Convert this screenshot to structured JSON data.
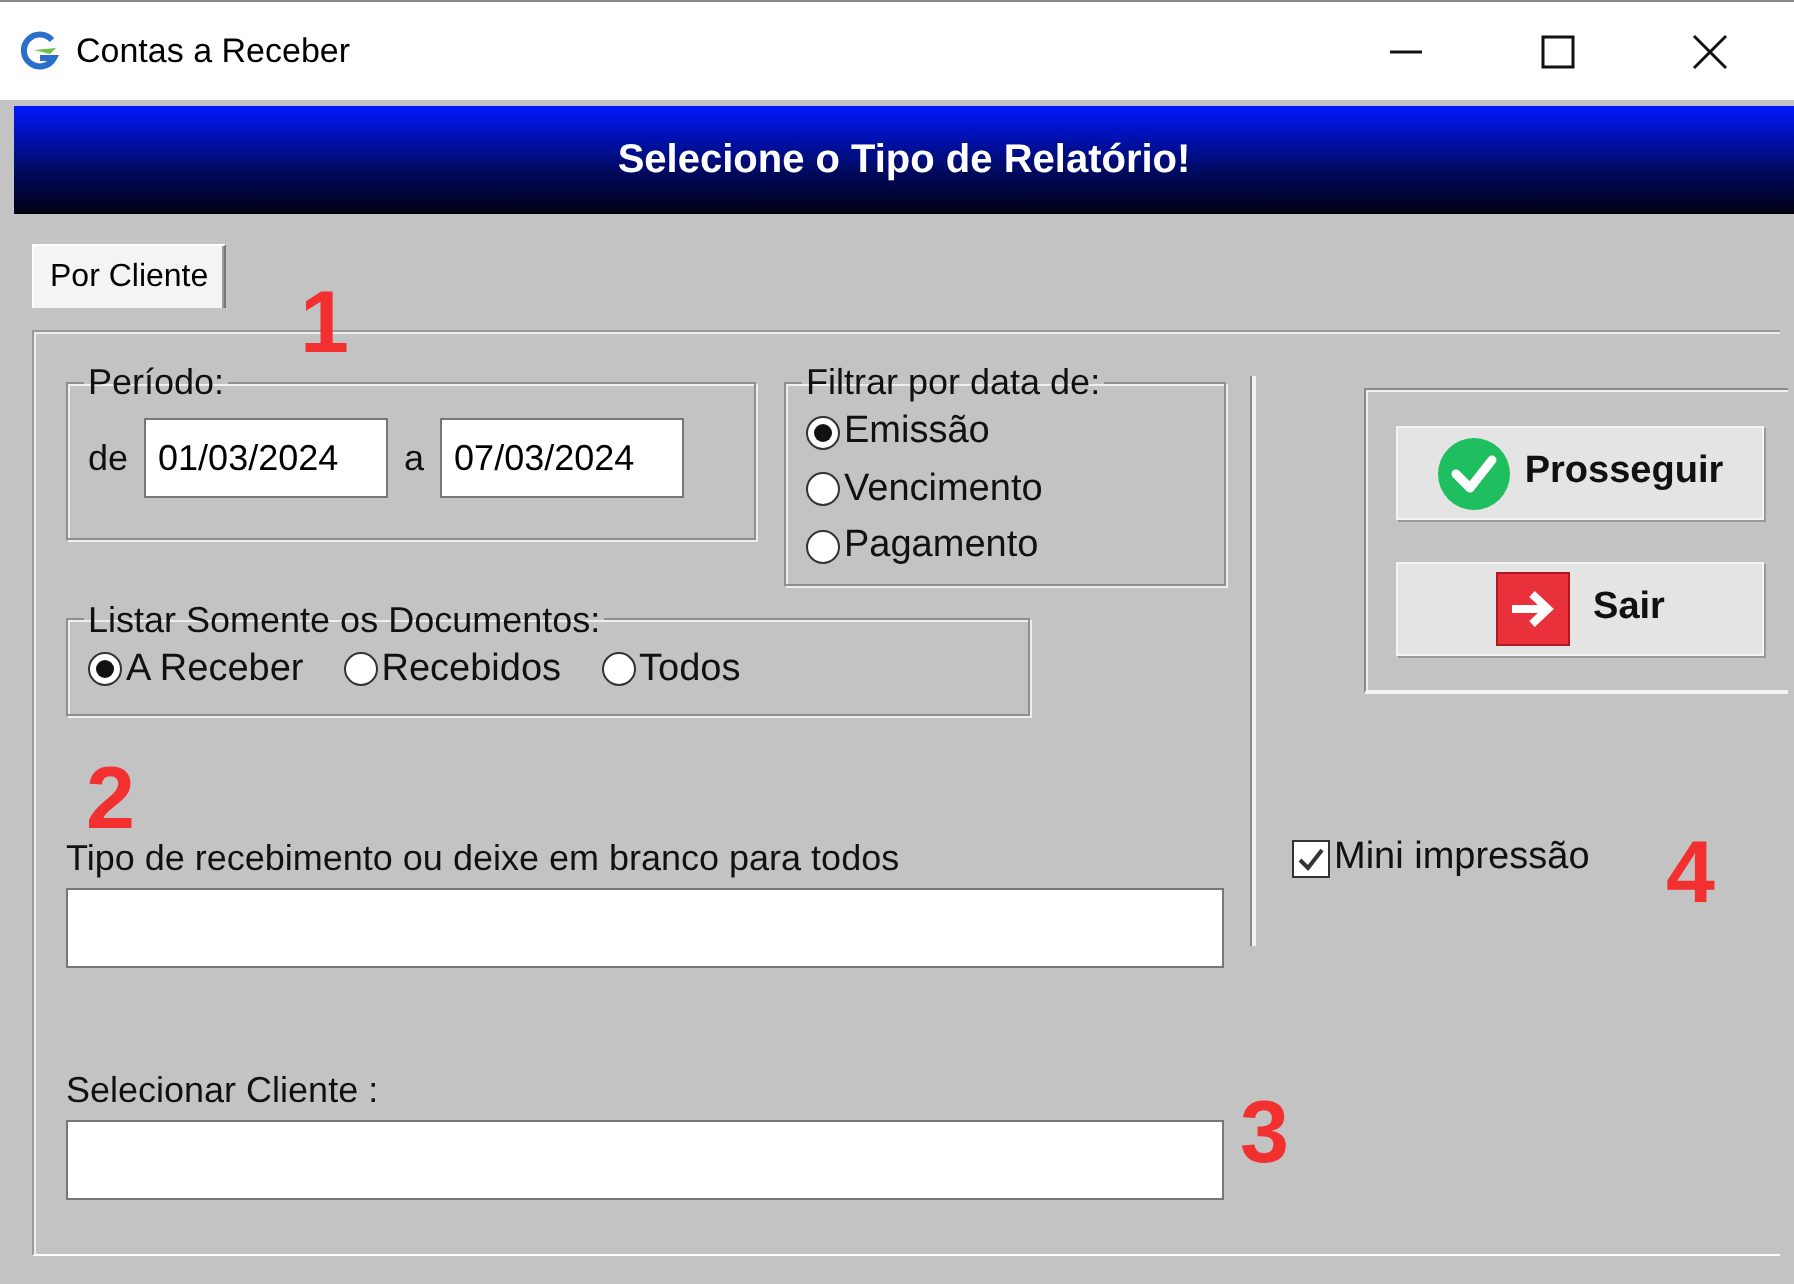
{
  "window": {
    "title": "Contas a Receber"
  },
  "header": {
    "title": "Selecione o Tipo de Relatório!"
  },
  "tabs": [
    {
      "label": "Por Cliente",
      "selected": true
    }
  ],
  "periodo": {
    "label": "Período:",
    "from_label": "de",
    "from": "01/03/2024",
    "to_label": "a",
    "to": "07/03/2024"
  },
  "filter": {
    "label": "Filtrar por data de:",
    "options": [
      {
        "label": "Emissão",
        "selected": true
      },
      {
        "label": "Vencimento",
        "selected": false
      },
      {
        "label": "Pagamento",
        "selected": false
      }
    ]
  },
  "documents": {
    "label": "Listar Somente os Documentos:",
    "options": [
      {
        "label": "A Receber",
        "selected": true
      },
      {
        "label": "Recebidos",
        "selected": false
      },
      {
        "label": "Todos",
        "selected": false
      }
    ]
  },
  "tipo_recebimento": {
    "label": "Tipo de recebimento ou deixe em branco para todos"
  },
  "cliente": {
    "label": "Selecionar Cliente :"
  },
  "buttons": [
    {
      "label": "Prosseguir",
      "kind": "proceed"
    },
    {
      "label": "Sair",
      "kind": "exit"
    }
  ],
  "mini_impressao": {
    "label": "Mini impressão",
    "checked": true
  },
  "annotations": [
    {
      "label": "1"
    },
    {
      "label": "2"
    },
    {
      "label": "3"
    },
    {
      "label": "4"
    }
  ]
}
